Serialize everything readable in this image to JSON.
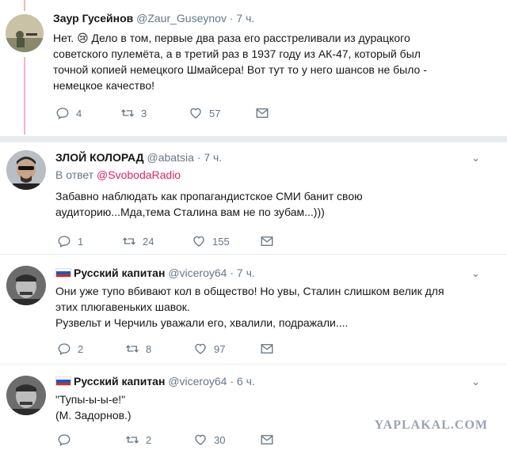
{
  "colors": {
    "accent": "#e0245e",
    "thread_line": "#f5b3c3",
    "muted": "#657786"
  },
  "tweets": [
    {
      "name": "Заур Гусейнов",
      "handle": "@Zaur_Guseynov",
      "dot": "·",
      "time": "7 ч.",
      "lines": [
        "Нет. 😢 Дело в том, первые два раза его расстреливали из дурацкого",
        "советского пулемёта, а в третий раз в 1937 году из АК-47, который был",
        "точной копией немецкого Шмайсера! Вот тут то у него шансов не было -",
        "немецкое качество!"
      ],
      "replies": "4",
      "retweets": "3",
      "likes": "57"
    },
    {
      "name": "ЗЛОЙ КОЛОРАД",
      "handle": "@abatsia",
      "dot": "·",
      "time": "7 ч.",
      "reply_prefix": "В ответ",
      "reply_mention": "@SvobodaRadio",
      "lines": [
        "Забавно наблюдать как пропагандистское СМИ банит свою",
        "аудиторию...Мда,тема Сталина вам не по зубам...)))"
      ],
      "replies": "1",
      "retweets": "24",
      "likes": "155"
    },
    {
      "name": "Русский капитан",
      "handle": "@viceroy64",
      "dot": "·",
      "time": "7 ч.",
      "lines": [
        "Они уже тупо вбивают кол в общество! Но увы, Сталин слишком велик для",
        "этих плюгавеньких шавок.",
        "Рузвельт и Черчиль уважали его,  хвалили, подражали...."
      ],
      "replies": "2",
      "retweets": "8",
      "likes": "97"
    },
    {
      "name": "Русский капитан",
      "handle": "@viceroy64",
      "dot": "·",
      "time": "6 ч.",
      "lines": [
        "\"Тупы-ы-ы-е!\"",
        "(М. Задорнов.)"
      ],
      "replies": "",
      "retweets": "2",
      "likes": "30"
    }
  ],
  "watermark": "YAPLAKAL.COM"
}
